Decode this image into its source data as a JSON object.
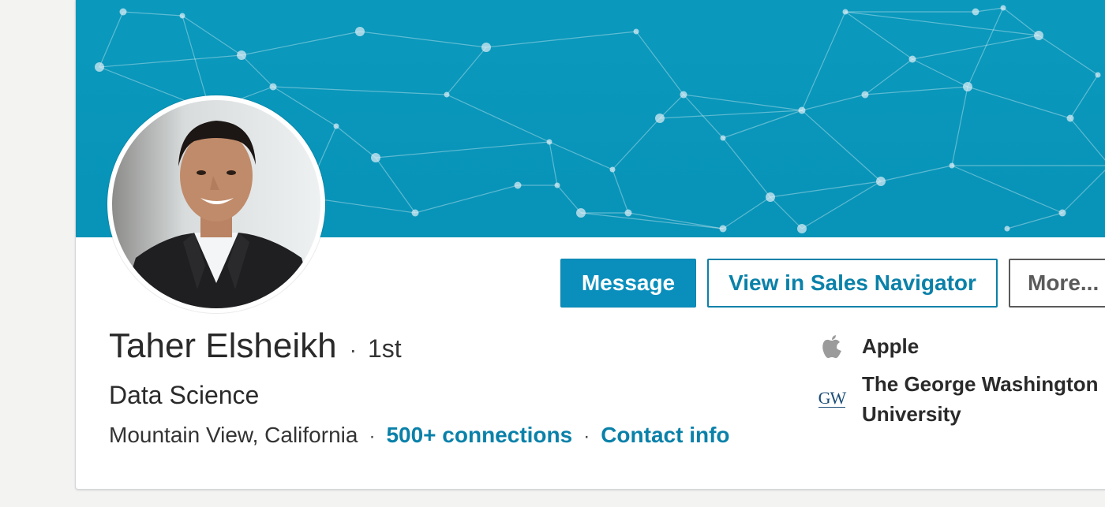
{
  "profile": {
    "name": "Taher Elsheikh",
    "separator": "·",
    "degree": "1st",
    "headline": "Data Science",
    "location": "Mountain View, California",
    "connections": "500+ connections",
    "contact_info": "Contact info"
  },
  "actions": {
    "message": "Message",
    "sales_navigator": "View in Sales Navigator",
    "more": "More..."
  },
  "sidebar": {
    "company": {
      "icon": "apple-logo-icon",
      "label": "Apple"
    },
    "school": {
      "icon": "gw-logo-icon",
      "logo_text": "GW",
      "label_line1": "The George Washington",
      "label_line2": "University"
    }
  },
  "colors": {
    "banner": "#0a99bd",
    "primary": "#0a8fbd",
    "link": "#0a81a9"
  }
}
